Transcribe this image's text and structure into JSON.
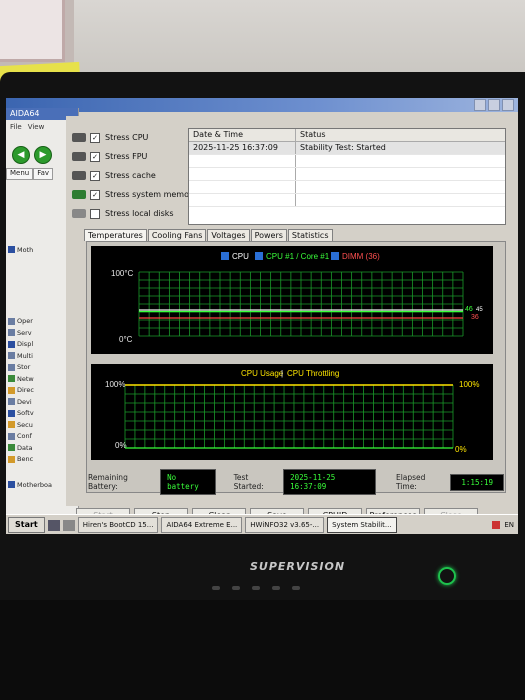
{
  "aida": {
    "title": "AIDA64",
    "menu": [
      "File",
      "View"
    ],
    "tabs": [
      "Menu",
      "Fav"
    ],
    "tree": [
      "Moth",
      "Oper",
      "Serv",
      "Displ",
      "Multi",
      "Stor",
      "Netw",
      "Direc",
      "Devi",
      "Softv",
      "Secu",
      "Conf",
      "Data",
      "Benc"
    ],
    "footer": "Motherboa"
  },
  "stability": {
    "checks": [
      {
        "label": "Stress CPU",
        "checked": true
      },
      {
        "label": "Stress FPU",
        "checked": true
      },
      {
        "label": "Stress cache",
        "checked": true
      },
      {
        "label": "Stress system memory",
        "checked": true
      },
      {
        "label": "Stress local disks",
        "checked": false
      }
    ],
    "log": {
      "col_date": "Date & Time",
      "col_status": "Status",
      "rows": [
        {
          "date": "2025-11-25 16:37:09",
          "status": "Stability Test: Started"
        }
      ]
    },
    "tabs": [
      "Temperatures",
      "Cooling Fans",
      "Voltages",
      "Powers",
      "Statistics"
    ],
    "active_tab": "Temperatures",
    "temp_graph": {
      "legend": [
        "CPU",
        "CPU #1 / Core #1",
        "DIMM (36)"
      ],
      "legend_colors": [
        "#ffffff",
        "#39ff3a",
        "#ff5050"
      ],
      "y_top": "100°C",
      "y_bottom": "0°C",
      "right_labels": [
        "46",
        "45",
        "36"
      ]
    },
    "usage_graph": {
      "title_usage": "CPU Usage",
      "separator": "|",
      "title_throttle": "CPU Throttling",
      "left_top": "100%",
      "left_bottom": "0%",
      "right_top": "100%",
      "right_bottom": "0%"
    },
    "status": {
      "battery_label": "Remaining Battery:",
      "battery_value": "No battery",
      "started_label": "Test Started:",
      "started_value": "2025-11-25 16:37:09",
      "elapsed_label": "Elapsed Time:",
      "elapsed_value": "1:15:19"
    },
    "buttons": [
      "Start",
      "Stop",
      "Clear",
      "Save",
      "CPUID",
      "Preferences",
      "Close"
    ]
  },
  "taskbar": {
    "start": "Start",
    "tasks": [
      "Hiren's BootCD 15...",
      "AIDA64 Extreme E...",
      "HWiNFO32 v3.65-...",
      "System Stabilit..."
    ],
    "tray": "EN"
  },
  "monitor": {
    "brand": "SUPERVISION"
  }
}
